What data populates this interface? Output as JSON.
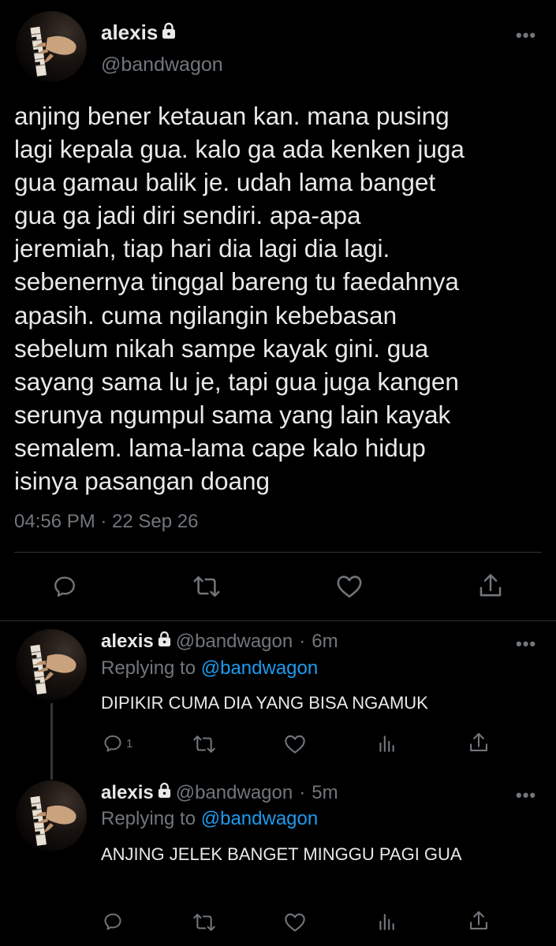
{
  "main_tweet": {
    "author_name": "alexis",
    "author_handle": "@bandwagon",
    "text": "anjing bener ketauan kan. mana pusing\nlagi kepala gua. kalo ga ada kenken juga\ngua gamau balik je. udah lama banget\ngua ga jadi diri sendiri. apa-apa\njeremiah, tiap hari dia lagi dia lagi.\nsebenernya tinggal bareng tu faedahnya\napasih. cuma ngilangin kebebasan\nsebelum nikah sampe kayak gini. gua\nsayang sama lu je, tapi gua juga kangen\nserunya ngumpul sama yang lain kayak\nsemalem. lama-lama cape kalo hidup\nisinya pasangan doang",
    "timestamp": "04:56 PM · 22 Sep 26",
    "more_label": "•••"
  },
  "replies": [
    {
      "author_name": "alexis",
      "author_handle": "@bandwagon",
      "separator": "·",
      "time": "6m",
      "replying_label": "Replying to",
      "replying_to": "@bandwagon",
      "text": "DIPIKIR CUMA DIA YANG BISA NGAMUK",
      "reply_count": "1",
      "more_label": "•••"
    },
    {
      "author_name": "alexis",
      "author_handle": "@bandwagon",
      "separator": "·",
      "time": "5m",
      "replying_label": "Replying to",
      "replying_to": "@bandwagon",
      "text": "ANJING JELEK BANGET MINGGU PAGI GUA",
      "more_label": "•••"
    }
  ],
  "icons": {
    "reply": "comment-icon",
    "retweet": "retweet-icon",
    "like": "heart-icon",
    "share": "share-icon",
    "analytics": "analytics-icon",
    "lock": "lock-icon"
  },
  "colors": {
    "background": "#000000",
    "text": "#e7e9ea",
    "muted": "#71767b",
    "accent": "#1d9bf0",
    "divider": "#2f3336"
  }
}
